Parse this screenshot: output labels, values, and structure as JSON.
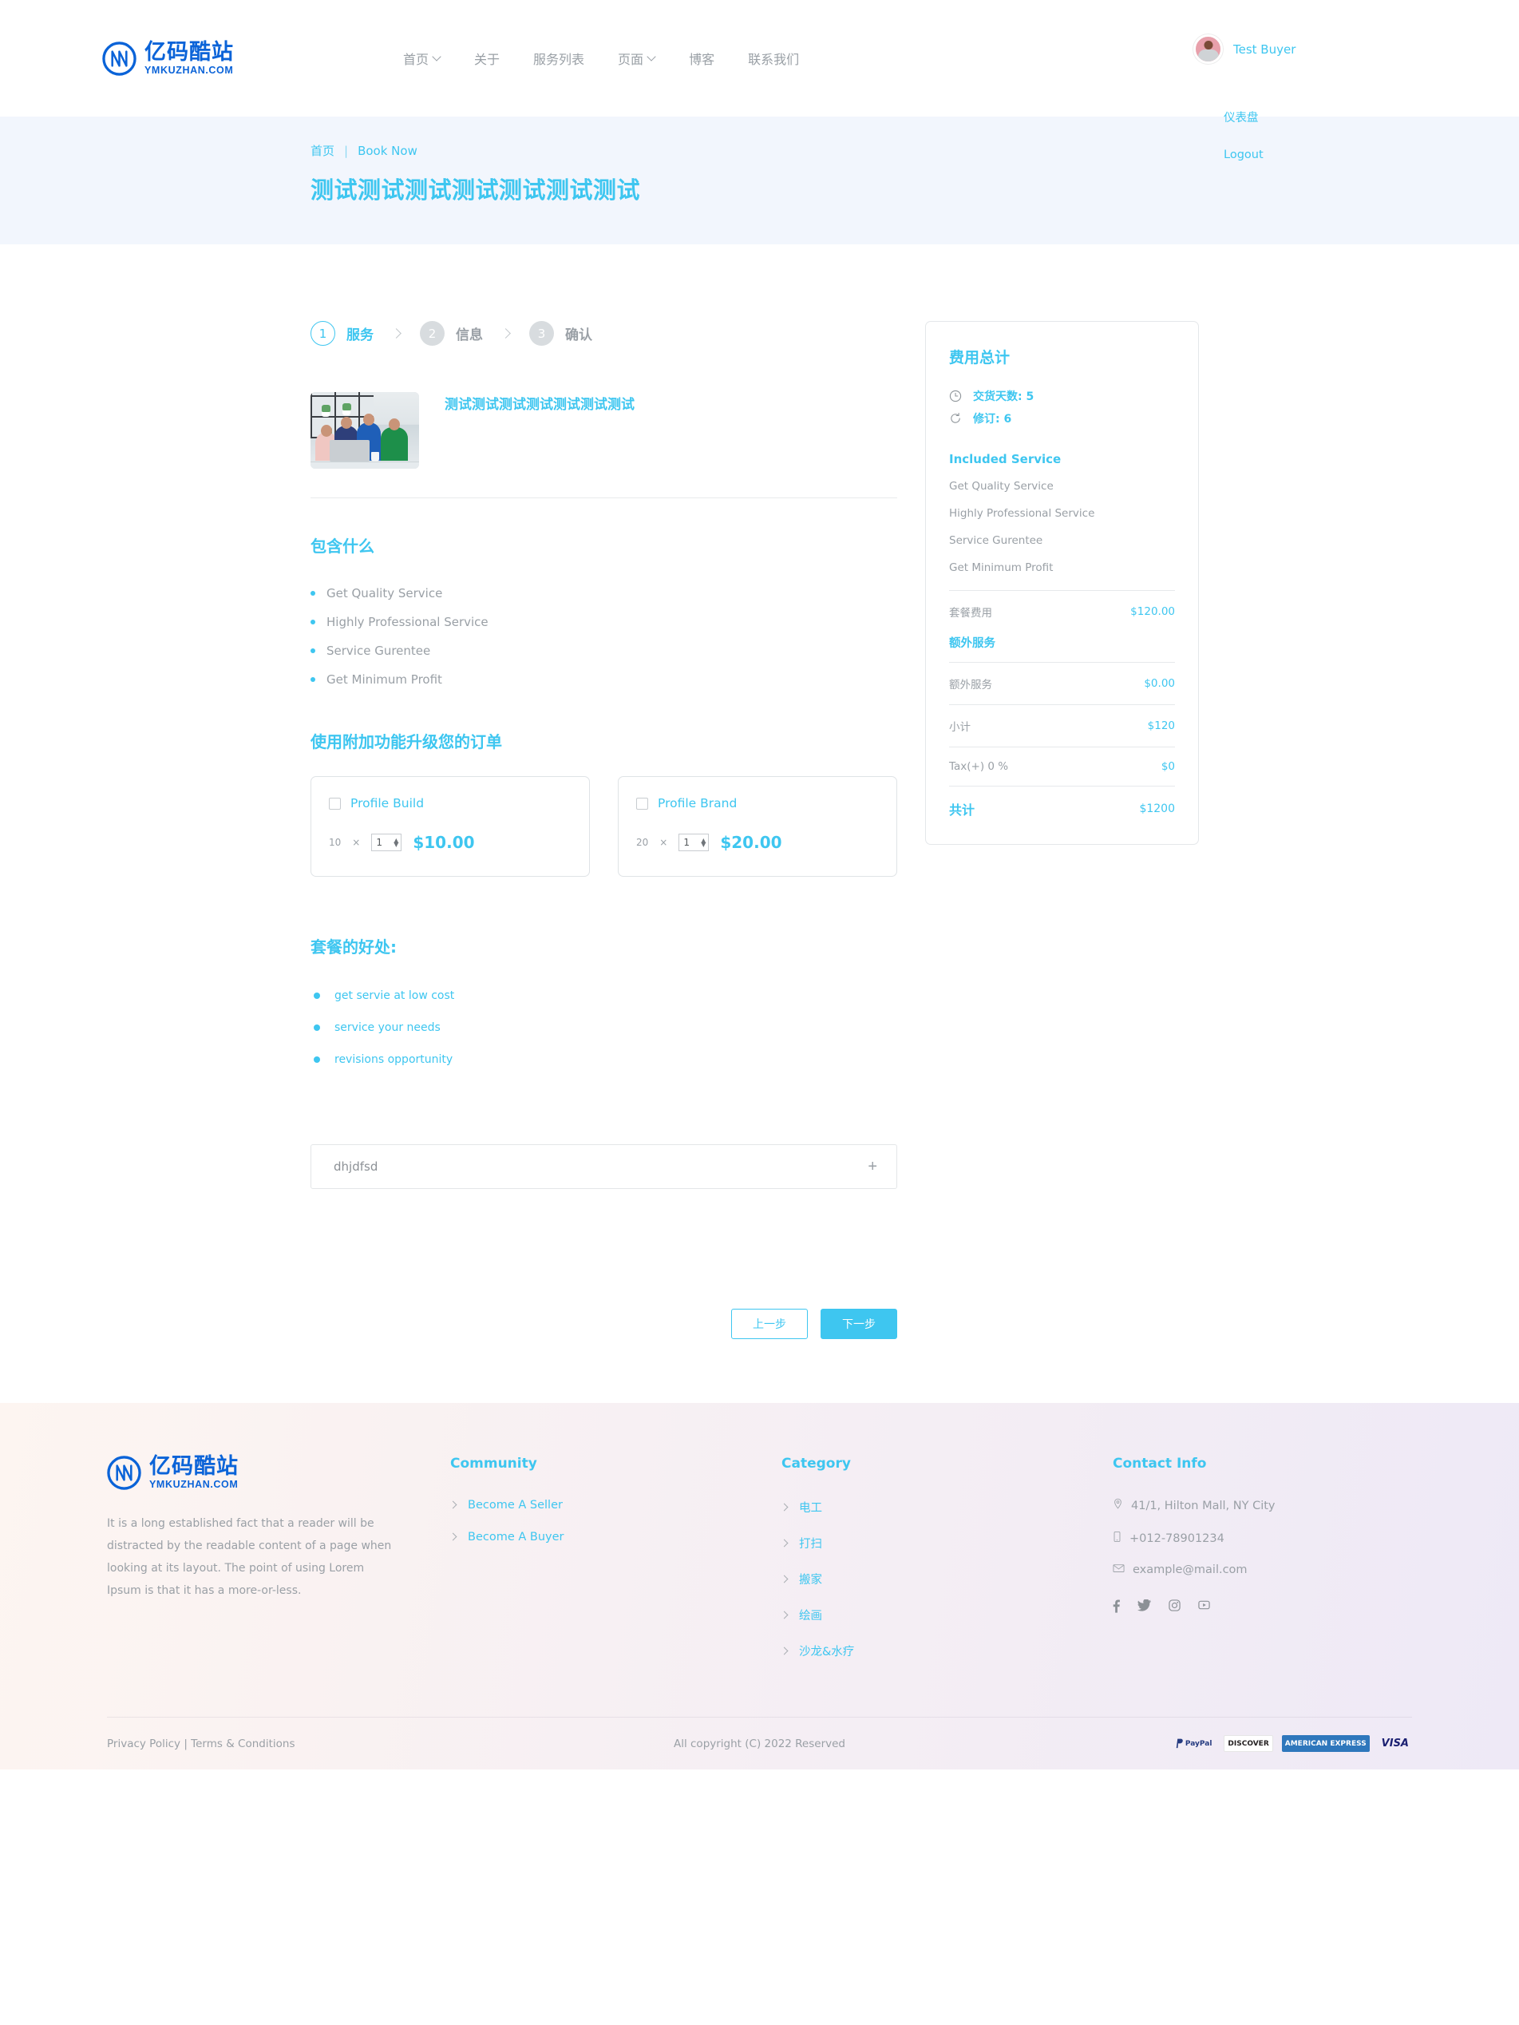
{
  "brand": {
    "cn": "亿码酷站",
    "en": "YMKUZHAN.COM"
  },
  "nav": {
    "items": [
      {
        "label": "首页",
        "has_caret": true
      },
      {
        "label": "关于",
        "has_caret": false
      },
      {
        "label": "服务列表",
        "has_caret": false
      },
      {
        "label": "页面",
        "has_caret": true
      },
      {
        "label": "博客",
        "has_caret": false
      },
      {
        "label": "联系我们",
        "has_caret": false
      }
    ]
  },
  "user": {
    "name": "Test Buyer",
    "menu": [
      {
        "label": "仪表盘"
      },
      {
        "label": "Logout"
      }
    ]
  },
  "banner": {
    "crumb_home": "首页",
    "crumb_sep": "|",
    "crumb_current": "Book Now",
    "title": "测试测试测试测试测试测试测试"
  },
  "stepper": [
    {
      "num": "1",
      "label": "服务",
      "state": "active"
    },
    {
      "num": "2",
      "label": "信息",
      "state": "idle"
    },
    {
      "num": "3",
      "label": "确认",
      "state": "idle"
    }
  ],
  "service": {
    "title": "测试测试测试测试测试测试测试"
  },
  "includes": {
    "heading": "包含什么",
    "items": [
      "Get Quality Service",
      "Highly Professional Service",
      "Service Gurentee",
      "Get Minimum Profit"
    ]
  },
  "addons": {
    "heading": "使用附加功能升级您的订单",
    "items": [
      {
        "name": "Profile Build",
        "unit": "10",
        "times": "×",
        "qty": "1",
        "price": "$10.00"
      },
      {
        "name": "Profile Brand",
        "unit": "20",
        "times": "×",
        "qty": "1",
        "price": "$20.00"
      }
    ]
  },
  "benefits": {
    "heading": "套餐的好处:",
    "items": [
      "get servie at low cost",
      "service your needs",
      "revisions opportunity"
    ]
  },
  "accordion": {
    "items": [
      {
        "label": "dhjdfsd",
        "toggle": "+"
      }
    ]
  },
  "wizard_buttons": {
    "prev": "上一步",
    "next": "下一步"
  },
  "summary": {
    "title": "费用总计",
    "delivery": "交货天数: 5",
    "revision": "修订: 6",
    "included_title": "Included Service",
    "included": [
      "Get Quality Service",
      "Highly Professional Service",
      "Service Gurentee",
      "Get Minimum Profit"
    ],
    "rows": [
      {
        "label": "套餐费用",
        "value": "$120.00",
        "style": "plain"
      },
      {
        "label": "额外服务",
        "value": "",
        "style": "section"
      },
      {
        "label": "额外服务",
        "value": "$0.00",
        "style": "plain"
      },
      {
        "label": "小计",
        "value": "$120",
        "style": "plain"
      },
      {
        "label": "Tax(+) 0 %",
        "value": "$0",
        "style": "plain"
      },
      {
        "label": "共计",
        "value": "$1200",
        "style": "total"
      }
    ]
  },
  "footer": {
    "about_text": "It is a long established fact that a reader will be distracted by the readable content of a page when looking at its layout. The point of using Lorem Ipsum is that it has a more-or-less.",
    "community": {
      "title": "Community",
      "links": [
        "Become A Seller",
        "Become A Buyer"
      ]
    },
    "category": {
      "title": "Category",
      "links": [
        "电工",
        "打扫",
        "搬家",
        "绘画",
        "沙龙&水疗"
      ]
    },
    "contact": {
      "title": "Contact Info",
      "address": "41/1, Hilton Mall, NY City",
      "phone": "+012-78901234",
      "email": "example@mail.com",
      "socials": [
        "facebook-icon",
        "twitter-icon",
        "instagram-icon",
        "youtube-icon"
      ]
    },
    "bottom": {
      "privacy": "Privacy Policy",
      "sep": "|",
      "terms": "Terms & Conditions",
      "copyright": "All copyright (C) 2022 Reserved",
      "payments": [
        "PayPal",
        "DISCOVER",
        "AMERICAN EXPRESS",
        "VISA"
      ]
    }
  },
  "colors": {
    "accent": "#3ec6f0",
    "brand_blue": "#0a63d8",
    "muted": "#9aa0a6",
    "banner_bg": "#f2f6fd"
  }
}
